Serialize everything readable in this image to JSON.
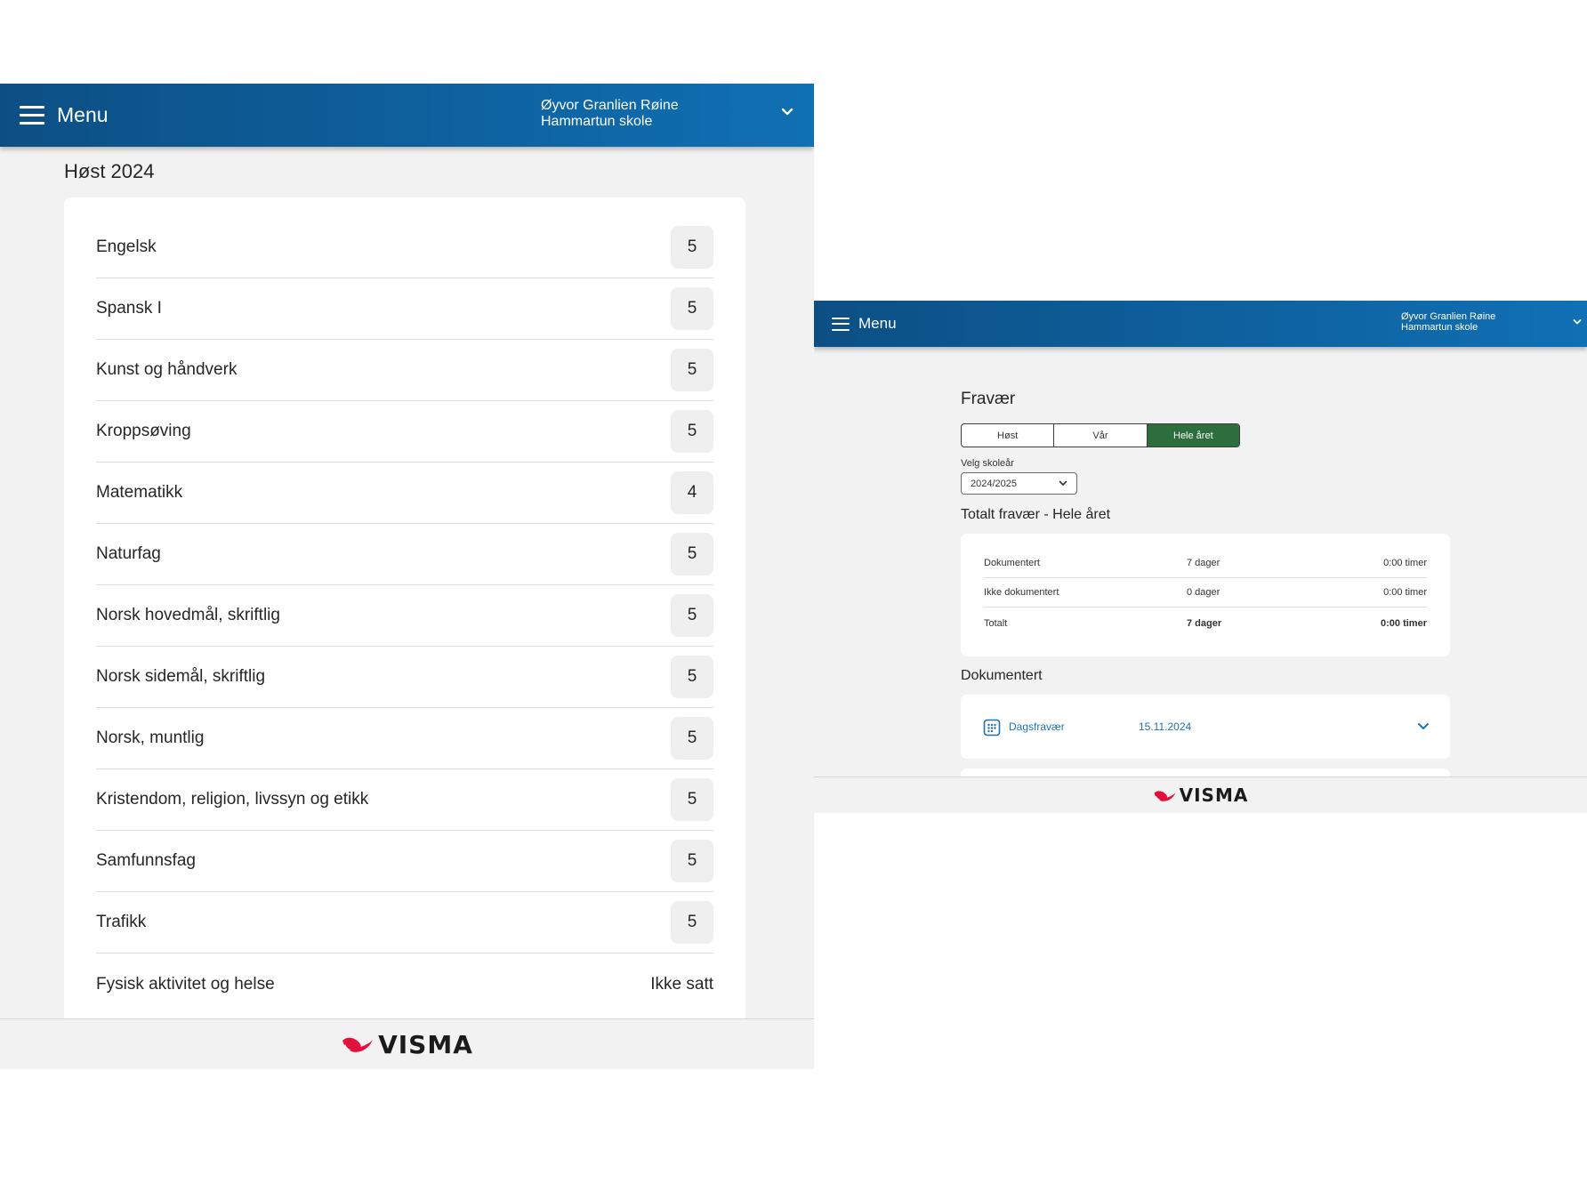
{
  "colors": {
    "header_gradient_start": "#0c4f84",
    "header_gradient_end": "#1070b4",
    "active_segment": "#2d6e3e",
    "link_blue": "#1a73b8",
    "visma_red": "#e4103c"
  },
  "left_screen": {
    "header": {
      "menu_label": "Menu",
      "user_name": "Øyvor Granlien Røine",
      "school": "Hammartun skole",
      "icons": [
        "hamburger-icon",
        "chevron-down-icon"
      ]
    },
    "section_title": "Høst 2024",
    "grades": [
      {
        "subject": "Engelsk",
        "grade": "5"
      },
      {
        "subject": "Spansk I",
        "grade": "5"
      },
      {
        "subject": "Kunst og håndverk",
        "grade": "5"
      },
      {
        "subject": "Kroppsøving",
        "grade": "5"
      },
      {
        "subject": "Matematikk",
        "grade": "4"
      },
      {
        "subject": "Naturfag",
        "grade": "5"
      },
      {
        "subject": "Norsk hovedmål, skriftlig",
        "grade": "5"
      },
      {
        "subject": "Norsk sidemål, skriftlig",
        "grade": "5"
      },
      {
        "subject": "Norsk, muntlig",
        "grade": "5"
      },
      {
        "subject": "Kristendom, religion, livssyn og etikk",
        "grade": "5"
      },
      {
        "subject": "Samfunnsfag",
        "grade": "5"
      },
      {
        "subject": "Trafikk",
        "grade": "5"
      },
      {
        "subject": "Fysisk aktivitet og helse",
        "grade": "Ikke satt"
      }
    ],
    "footer": {
      "logo_text": "VISMA"
    }
  },
  "right_screen": {
    "header": {
      "menu_label": "Menu",
      "user_name": "Øyvor Granlien Røine",
      "school": "Hammartun skole",
      "icons": [
        "hamburger-icon",
        "chevron-down-icon"
      ]
    },
    "page_title": "Fravær",
    "period_tabs": [
      {
        "label": "Høst",
        "active": false
      },
      {
        "label": "Vår",
        "active": false
      },
      {
        "label": "Hele året",
        "active": true
      }
    ],
    "school_year": {
      "label": "Velg skoleår",
      "value": "2024/2025"
    },
    "total_title": "Totalt fravær - Hele året",
    "totals": [
      {
        "label": "Dokumentert",
        "days": "7 dager",
        "hours": "0:00 timer"
      },
      {
        "label": "Ikke dokumentert",
        "days": "0 dager",
        "hours": "0:00 timer"
      },
      {
        "label": "Totalt",
        "days": "7 dager",
        "hours": "0:00 timer"
      }
    ],
    "documented_title": "Dokumentert",
    "documented_items": [
      {
        "type": "Dagsfravær",
        "date": "15.11.2024",
        "icon": "calendar-icon"
      }
    ],
    "footer": {
      "logo_text": "VISMA"
    }
  }
}
